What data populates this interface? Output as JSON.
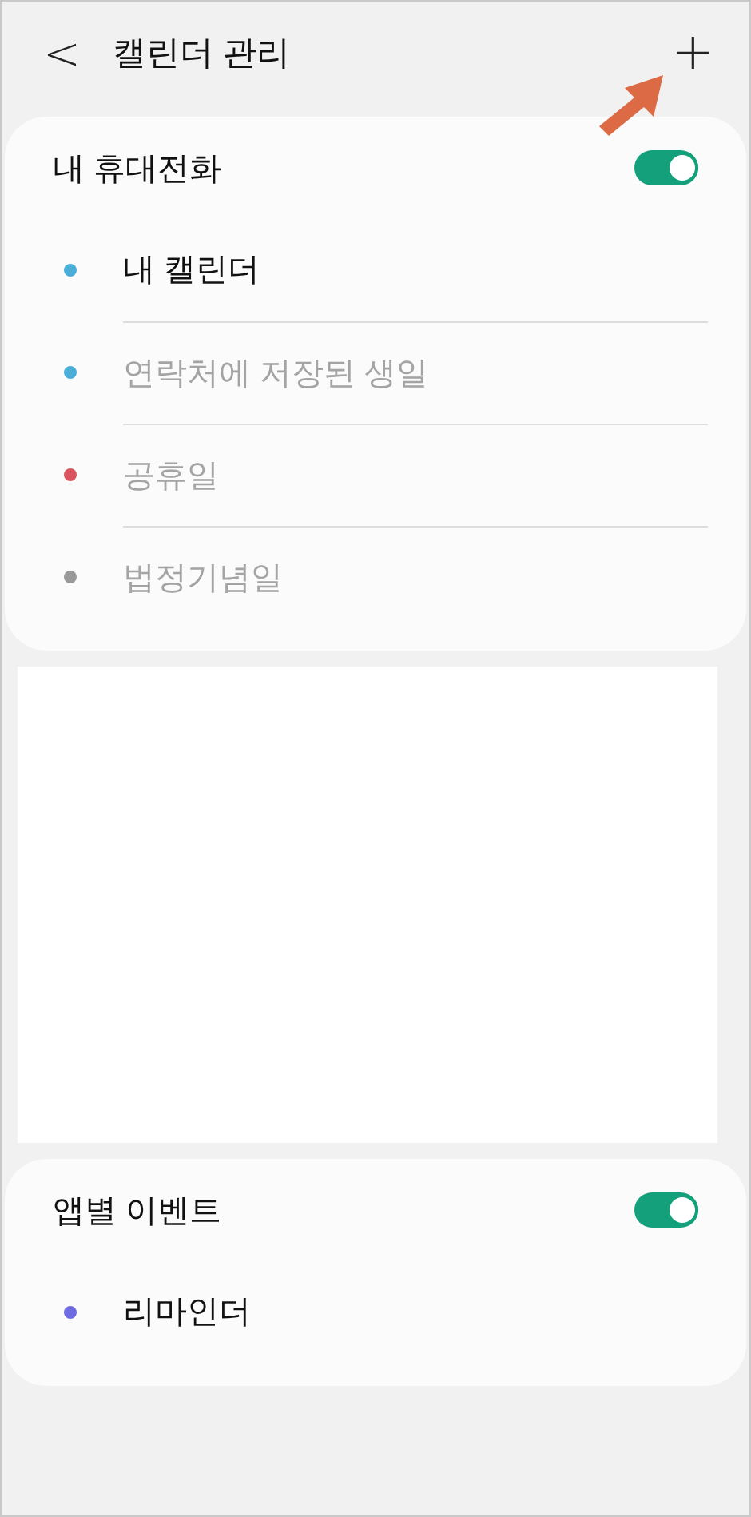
{
  "header": {
    "back_icon": "<",
    "title": "캘린더 관리",
    "add_icon": "+"
  },
  "sections": [
    {
      "title": "내 휴대전화",
      "on": true,
      "items": [
        {
          "label": "내 캘린더",
          "color": "#4aaed9",
          "disabled": false
        },
        {
          "label": "연락처에 저장된 생일",
          "color": "#4aaed9",
          "disabled": true
        },
        {
          "label": "공휴일",
          "color": "#d9545c",
          "disabled": true
        },
        {
          "label": "법정기념일",
          "color": "#999999",
          "disabled": true
        }
      ]
    },
    {
      "kind": "redacted"
    },
    {
      "title": "앱별 이벤트",
      "on": true,
      "items": [
        {
          "label": "리마인더",
          "color": "#6f6be0",
          "disabled": false
        }
      ]
    }
  ]
}
